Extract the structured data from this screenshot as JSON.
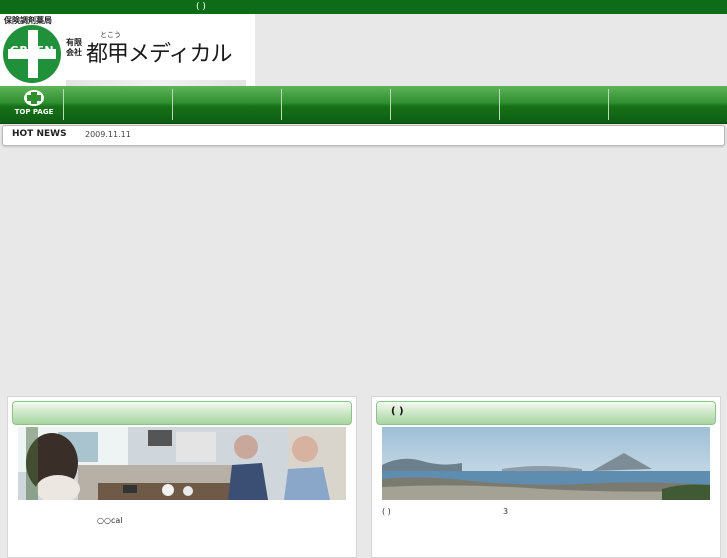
{
  "topbar": {
    "text": "( )"
  },
  "header": {
    "kicker": "保険調剤薬局",
    "logo_word": "GREEN",
    "company_type": "有限会社",
    "company_ruby": "とこう",
    "company_name": "都甲メディカル"
  },
  "nav": {
    "home_label": "TOP PAGE",
    "items": [
      "",
      "",
      "",
      "",
      "",
      ""
    ]
  },
  "hotnews": {
    "label": "HOT NEWS",
    "date": "2009.11.11"
  },
  "panels": {
    "left": {
      "title": "",
      "caption": "○○cal"
    },
    "right": {
      "title": "( )",
      "caption_left": "( )",
      "caption_right": "3"
    }
  },
  "colors": {
    "brand_green": "#0e6b18",
    "nav_green": "#2f8f2f",
    "panel_head": "#cfe8ca"
  }
}
